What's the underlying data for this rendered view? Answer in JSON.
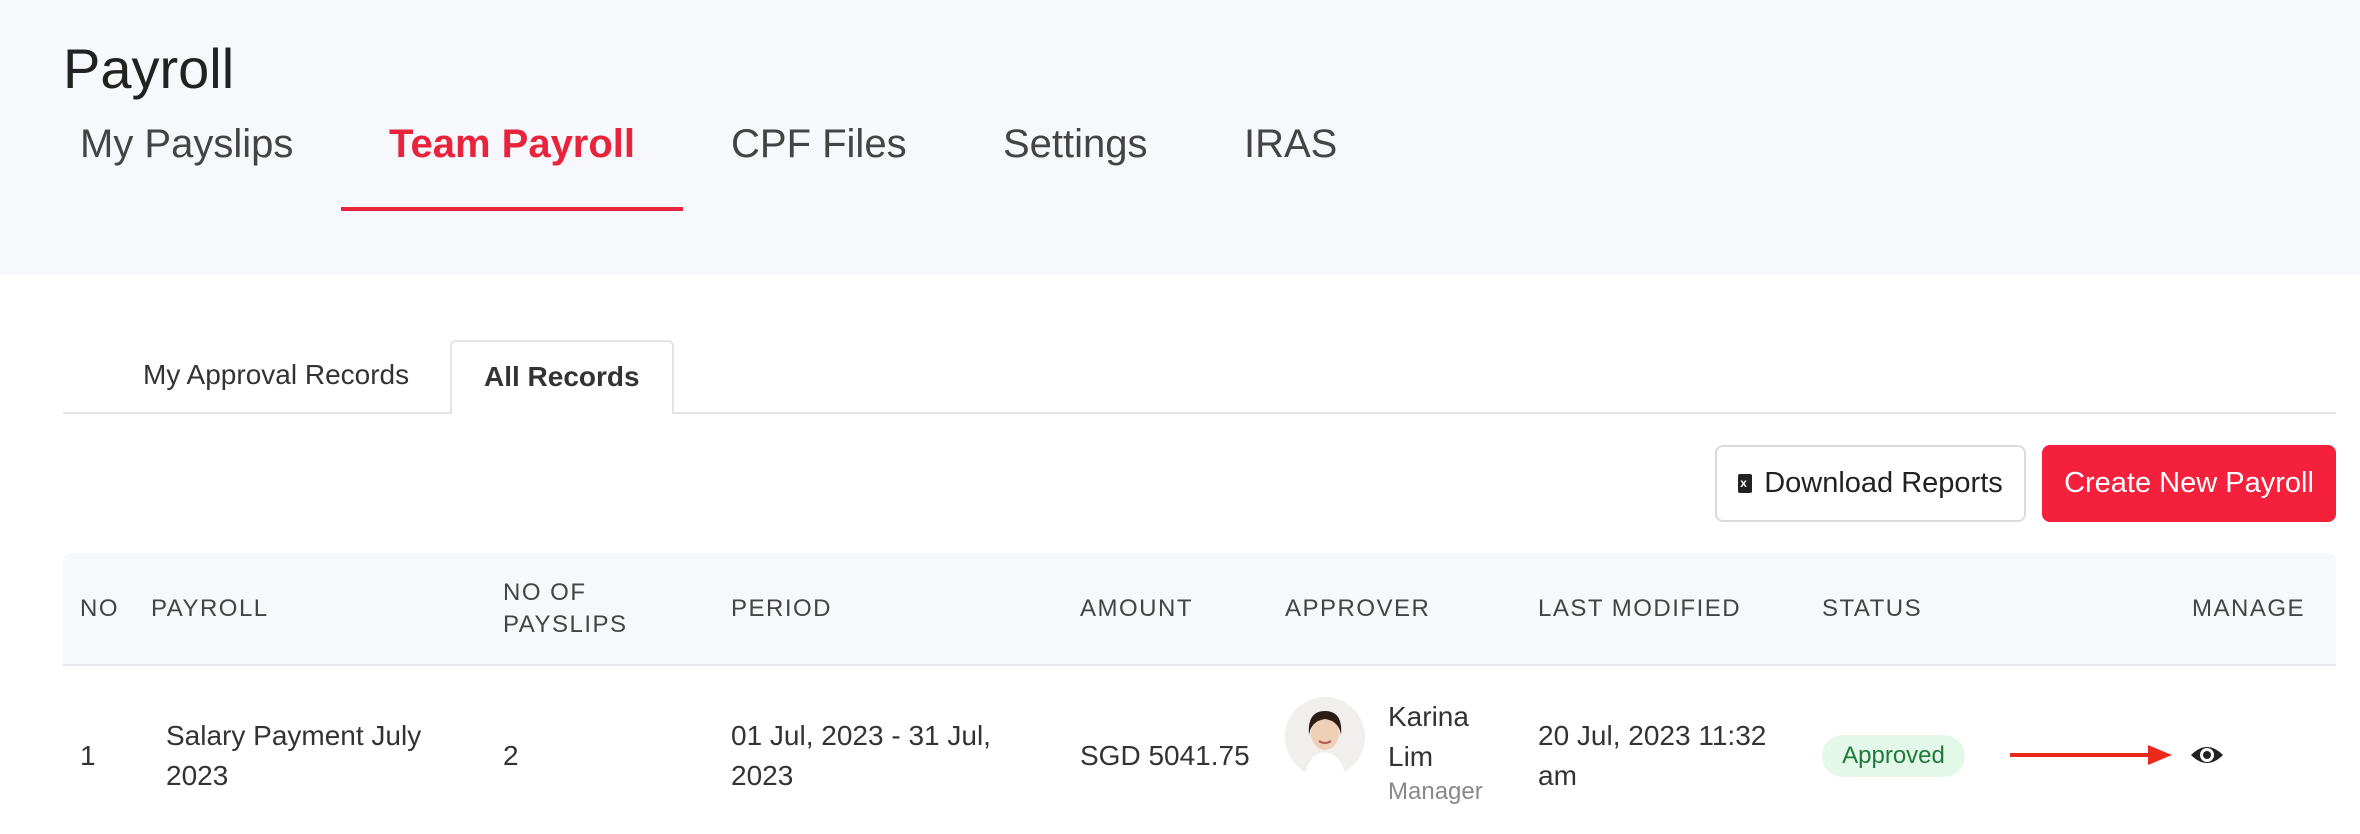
{
  "page": {
    "title": "Payroll"
  },
  "main_tabs": [
    {
      "label": "My Payslips"
    },
    {
      "label": "Team Payroll"
    },
    {
      "label": "CPF Files"
    },
    {
      "label": "Settings"
    },
    {
      "label": "IRAS"
    }
  ],
  "active_main_tab": "Team Payroll",
  "sub_tabs": [
    {
      "label": "My Approval Records"
    },
    {
      "label": "All Records"
    }
  ],
  "active_sub_tab": "All Records",
  "toolbar": {
    "download_label": "Download Reports",
    "create_label": "Create New Payroll"
  },
  "table": {
    "headers": {
      "no": "NO",
      "payroll": "PAYROLL",
      "no_of_payslips_1": "NO OF",
      "no_of_payslips_2": "PAYSLIPS",
      "period": "PERIOD",
      "amount": "AMOUNT",
      "approver": "APPROVER",
      "last_modified": "LAST MODIFIED",
      "status": "STATUS",
      "manage": "MANAGE"
    },
    "rows": [
      {
        "no": "1",
        "payroll_1": "Salary Payment July",
        "payroll_2": "2023",
        "payslips": "2",
        "period_1": "01 Jul, 2023 - 31 Jul,",
        "period_2": "2023",
        "amount": "SGD 5041.75",
        "approver_first": "Karina",
        "approver_last": "Lim",
        "approver_role": "Manager",
        "last_modified_1": "20 Jul, 2023 11:32",
        "last_modified_2": "am",
        "status": "Approved"
      }
    ]
  },
  "colors": {
    "accent": "#e8243c",
    "create_button": "#f5213c",
    "status_bg": "#e3f8e8",
    "status_text": "#1f7a3a",
    "annotation_arrow": "#e8291c"
  },
  "icons": {
    "download": "file-excel-icon",
    "manage": "eye-icon",
    "annotation": "arrow-right-icon"
  }
}
